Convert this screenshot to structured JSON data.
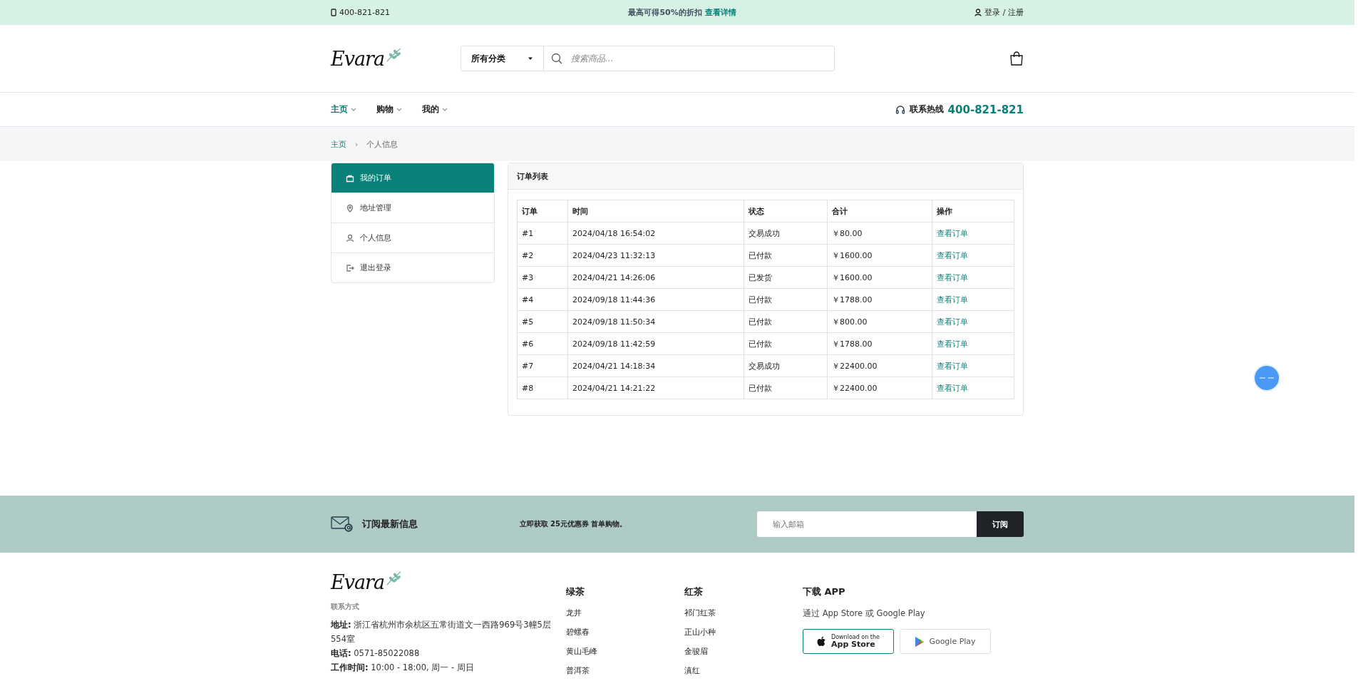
{
  "top_bar": {
    "phone": "400-821-821",
    "promo": "最高可得50%的折扣",
    "promo_link": "查看详情",
    "account": "登录 / 注册"
  },
  "header": {
    "logo": "Evara",
    "category": "所有分类",
    "search_placeholder": "搜索商品..."
  },
  "nav": {
    "items": [
      {
        "label": "主页",
        "selected": true
      },
      {
        "label": "购物",
        "selected": false
      },
      {
        "label": "我的",
        "selected": false
      }
    ],
    "hotline_label": "联系热线",
    "hotline": "400-821-821"
  },
  "breadcrumb": {
    "separator": "›",
    "items": [
      "主页",
      "个人信息"
    ]
  },
  "sidebar": {
    "items": [
      {
        "label": "我的订单",
        "selected": true
      },
      {
        "label": "地址管理",
        "selected": false
      },
      {
        "label": "个人信息",
        "selected": false
      },
      {
        "label": "退出登录",
        "selected": false
      }
    ]
  },
  "orders": {
    "title": "订单列表",
    "columns": [
      "订单",
      "时间",
      "状态",
      "合计",
      "操作"
    ],
    "rows": [
      [
        "#1",
        "2024/04/18 16:54:02",
        "交易成功",
        "￥80.00",
        "查看订单"
      ],
      [
        "#2",
        "2024/04/23 11:32:13",
        "已付款",
        "￥1600.00",
        "查看订单"
      ],
      [
        "#3",
        "2024/04/21 14:26:06",
        "已发货",
        "￥1600.00",
        "查看订单"
      ],
      [
        "#4",
        "2024/09/18 11:44:36",
        "已付款",
        "￥1788.00",
        "查看订单"
      ],
      [
        "#5",
        "2024/09/18 11:50:34",
        "已付款",
        "￥800.00",
        "查看订单"
      ],
      [
        "#6",
        "2024/09/18 11:42:59",
        "已付款",
        "￥1788.00",
        "查看订单"
      ],
      [
        "#7",
        "2024/04/21 14:18:34",
        "交易成功",
        "￥22400.00",
        "查看订单"
      ],
      [
        "#8",
        "2024/04/21 14:21:22",
        "已付款",
        "￥22400.00",
        "查看订单"
      ]
    ]
  },
  "newsletter": {
    "title": "订阅最新信息",
    "text": "立即获取 25元优惠券 首单购物。",
    "placeholder": "输入邮箱",
    "button": "订阅"
  },
  "footer": {
    "logo": "Evara",
    "contact_heading": "联系方式",
    "contacts": [
      "**地址:** 浙江省杭州市余杭区五常街道文一西路969号3幢5层554室",
      "**电话:** 0571-85022088",
      "**工作时间:** 10:00 - 18:00, 周一 - 周日"
    ],
    "columns": [
      {
        "heading": "绿茶",
        "links": [
          "龙井",
          "碧螺春",
          "黄山毛峰",
          "普洱茶"
        ]
      },
      {
        "heading": "红茶",
        "links": [
          "祁门红茶",
          "正山小种",
          "金骏眉",
          "滇红"
        ]
      }
    ],
    "app": {
      "heading": "下载 APP",
      "text": "通过 App Store 或 Google Play",
      "buttons": [
        {
          "kind": "apple",
          "small": "Download on the",
          "big": "App Store"
        },
        {
          "kind": "google",
          "big": "Google Play"
        }
      ]
    }
  }
}
